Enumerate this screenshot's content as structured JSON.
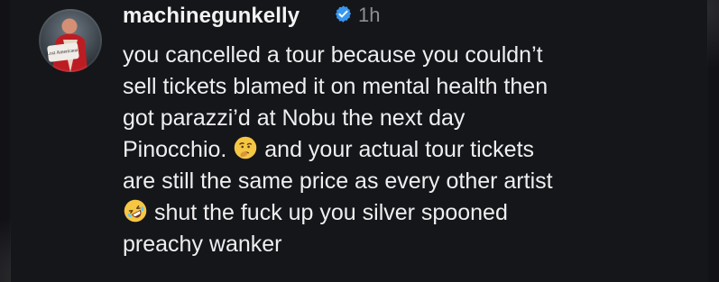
{
  "comment": {
    "username": "machinegunkelly",
    "time": "1h",
    "avatar_text": "Lost Americana",
    "verified_icon": "verified-badge-icon",
    "lines": {
      "l1": "you cancelled a tour because you couldn’t",
      "l2": "sell tickets blamed it on mental health then",
      "l3": "got parazzi’d at Nobu the next day",
      "l4a": "Pinocchio.",
      "l4b": "and your actual tour tickets",
      "l5": "are still the same price as every other artist",
      "l6": "shut the fuck up you silver spooned",
      "l7": "preachy wanker"
    },
    "emojis": {
      "thinking": "thinking-face-emoji",
      "laughing": "rolling-on-the-floor-laughing-emoji"
    }
  },
  "colors": {
    "background": "#121216",
    "text": "#efefef",
    "muted": "#8e8e93",
    "verified_blue": "#3897f0"
  }
}
